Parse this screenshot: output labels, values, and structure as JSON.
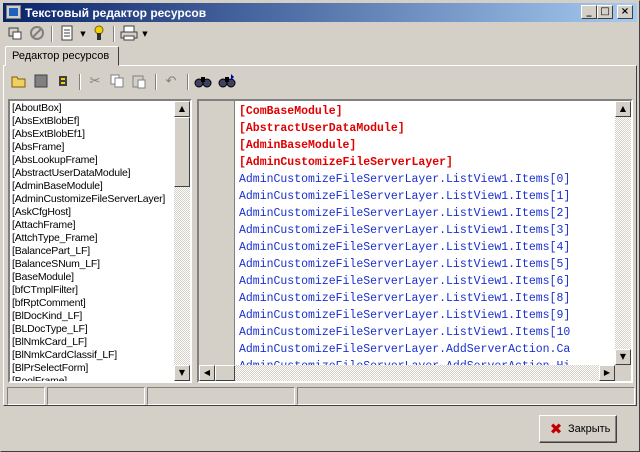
{
  "window": {
    "title": "Текстовый редактор ресурсов",
    "controls": {
      "minimize": "_",
      "maximize": "□",
      "close": "×"
    }
  },
  "toolbar_top": {
    "icons": [
      "connect-icon",
      "cancel-icon",
      "document-icon",
      "wizard-icon",
      "print-icon"
    ]
  },
  "tabs": [
    {
      "label": "Редактор ресурсов"
    }
  ],
  "toolbar_editor": {
    "icons": [
      "open-folder-icon",
      "save-icon",
      "debug-icon",
      "cut-icon",
      "copy-icon",
      "paste-icon",
      "undo-icon",
      "find-icon",
      "find-next-icon"
    ]
  },
  "resource_list": {
    "items": [
      "[AboutBox]",
      "[AbsExtBlobEf]",
      "[AbsExtBlobEf1]",
      "[AbsFrame]",
      "[AbsLookupFrame]",
      "[AbstractUserDataModule]",
      "[AdminBaseModule]",
      "[AdminCustomizeFileServerLayer]",
      "[AskCfgHost]",
      "[AttachFrame]",
      "[AttchType_Frame]",
      "[BalancePart_LF]",
      "[BalanceSNum_LF]",
      "[BaseModule]",
      "[bfCTmplFilter]",
      "[bfRptComment]",
      "[BlDocKind_LF]",
      "[BLDocType_LF]",
      "[BlNmkCard_LF]",
      "[BlNmkCardClassif_LF]",
      "[BlPrSelectForm]",
      "[BoolFrame]"
    ]
  },
  "editor": {
    "lines": [
      {
        "text": "[ComBaseModule]",
        "kind": "section"
      },
      {
        "text": "[AbstractUserDataModule]",
        "kind": "section"
      },
      {
        "text": "[AdminBaseModule]",
        "kind": "section"
      },
      {
        "text": "[AdminCustomizeFileServerLayer]",
        "kind": "section"
      },
      {
        "text": "AdminCustomizeFileServerLayer.ListView1.Items[0]",
        "kind": "key"
      },
      {
        "text": "AdminCustomizeFileServerLayer.ListView1.Items[1]",
        "kind": "key"
      },
      {
        "text": "AdminCustomizeFileServerLayer.ListView1.Items[2]",
        "kind": "key"
      },
      {
        "text": "AdminCustomizeFileServerLayer.ListView1.Items[3]",
        "kind": "key"
      },
      {
        "text": "AdminCustomizeFileServerLayer.ListView1.Items[4]",
        "kind": "key"
      },
      {
        "text": "AdminCustomizeFileServerLayer.ListView1.Items[5]",
        "kind": "key"
      },
      {
        "text": "AdminCustomizeFileServerLayer.ListView1.Items[6]",
        "kind": "key"
      },
      {
        "text": "AdminCustomizeFileServerLayer.ListView1.Items[8]",
        "kind": "key"
      },
      {
        "text": "AdminCustomizeFileServerLayer.ListView1.Items[9]",
        "kind": "key"
      },
      {
        "text": "AdminCustomizeFileServerLayer.ListView1.Items[10",
        "kind": "key"
      },
      {
        "text": "AdminCustomizeFileServerLayer.AddServerAction.Ca",
        "kind": "key"
      },
      {
        "text": "AdminCustomizeFileServerLayer.AddServerAction.Hi",
        "kind": "key"
      }
    ]
  },
  "buttons": {
    "close_label": "Закрыть"
  },
  "colors": {
    "section": "#e00000",
    "key": "#1a2fd0",
    "titlebar": "#0a246a"
  }
}
